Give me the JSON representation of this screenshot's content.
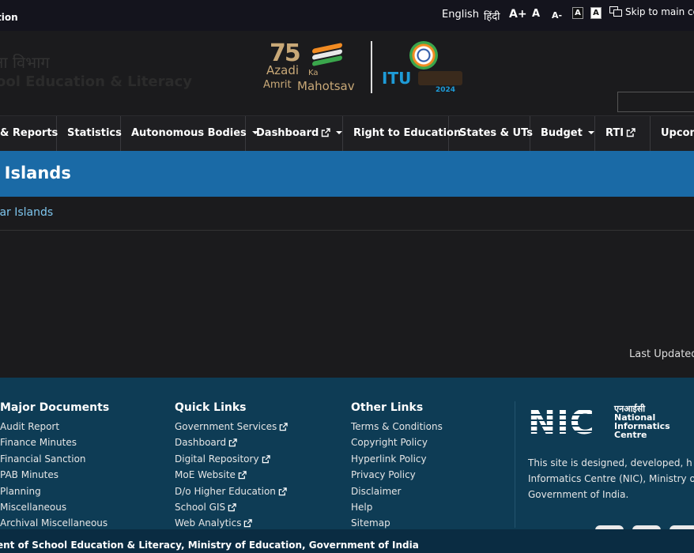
{
  "topbar": {
    "skip_left": "tion",
    "lang_english": "English",
    "lang_hindi": "हिंदी",
    "font_increase": "A+",
    "font_normal": "A",
    "font_decrease": "A-",
    "contrast_dark": "A",
    "contrast_light": "A",
    "skip_main": "Skip to main co"
  },
  "header": {
    "hindi_title": "क्षा विभाग",
    "dept_title": "ool Education & Literacy",
    "logo75": {
      "seventyfive": "75",
      "azadi": "Azadi",
      "ka": "Ka",
      "amrit": "Amrit",
      "mahotsav": "Mahotsav"
    },
    "itu": {
      "text": "ITU",
      "year": "2024"
    }
  },
  "nav": {
    "items": [
      {
        "label": "& Reports"
      },
      {
        "label": "Statistics"
      },
      {
        "label": "Autonomous Bodies"
      },
      {
        "label": "Dashboard"
      },
      {
        "label": "Right to Education"
      },
      {
        "label": "States & UTs"
      },
      {
        "label": "Budget"
      },
      {
        "label": "RTI"
      },
      {
        "label": "Upcom"
      }
    ]
  },
  "page": {
    "title": "r Islands",
    "breadcrumb": "obar Islands",
    "last_updated": "Last Updated I"
  },
  "footer": {
    "major_documents": {
      "heading": "Major Documents",
      "items": [
        "Audit Report",
        "Finance Minutes",
        "Financial Sanction",
        "PAB Minutes",
        "Planning",
        "Miscellaneous",
        "Archival Miscellaneous"
      ]
    },
    "quick_links": {
      "heading": "Quick Links",
      "items": [
        "Government Services",
        "Dashboard",
        "Digital Repository",
        "MoE Website",
        "D/o Higher Education",
        "School GIS",
        "Web Analytics"
      ]
    },
    "other_links": {
      "heading": "Other Links",
      "items": [
        "Terms & Conditions",
        "Copyright Policy",
        "Hyperlink Policy",
        "Privacy Policy",
        "Disclaimer",
        "Help",
        "Sitemap"
      ]
    },
    "nic": {
      "logo": "NIC",
      "hindi": "एनआईसी",
      "line1": "National",
      "line2": "Informatics",
      "line3": "Centre"
    },
    "designed_lines": [
      "This site is designed, developed, h",
      "Informatics Centre (NIC), Ministry of E",
      "Government of India."
    ],
    "bottom": "ent of School Education & Literacy, Ministry of Education, Government of India"
  },
  "colors": {
    "title_band": "#1a6aa6",
    "footer": "#0e3c55",
    "link": "#7ec6ee"
  }
}
